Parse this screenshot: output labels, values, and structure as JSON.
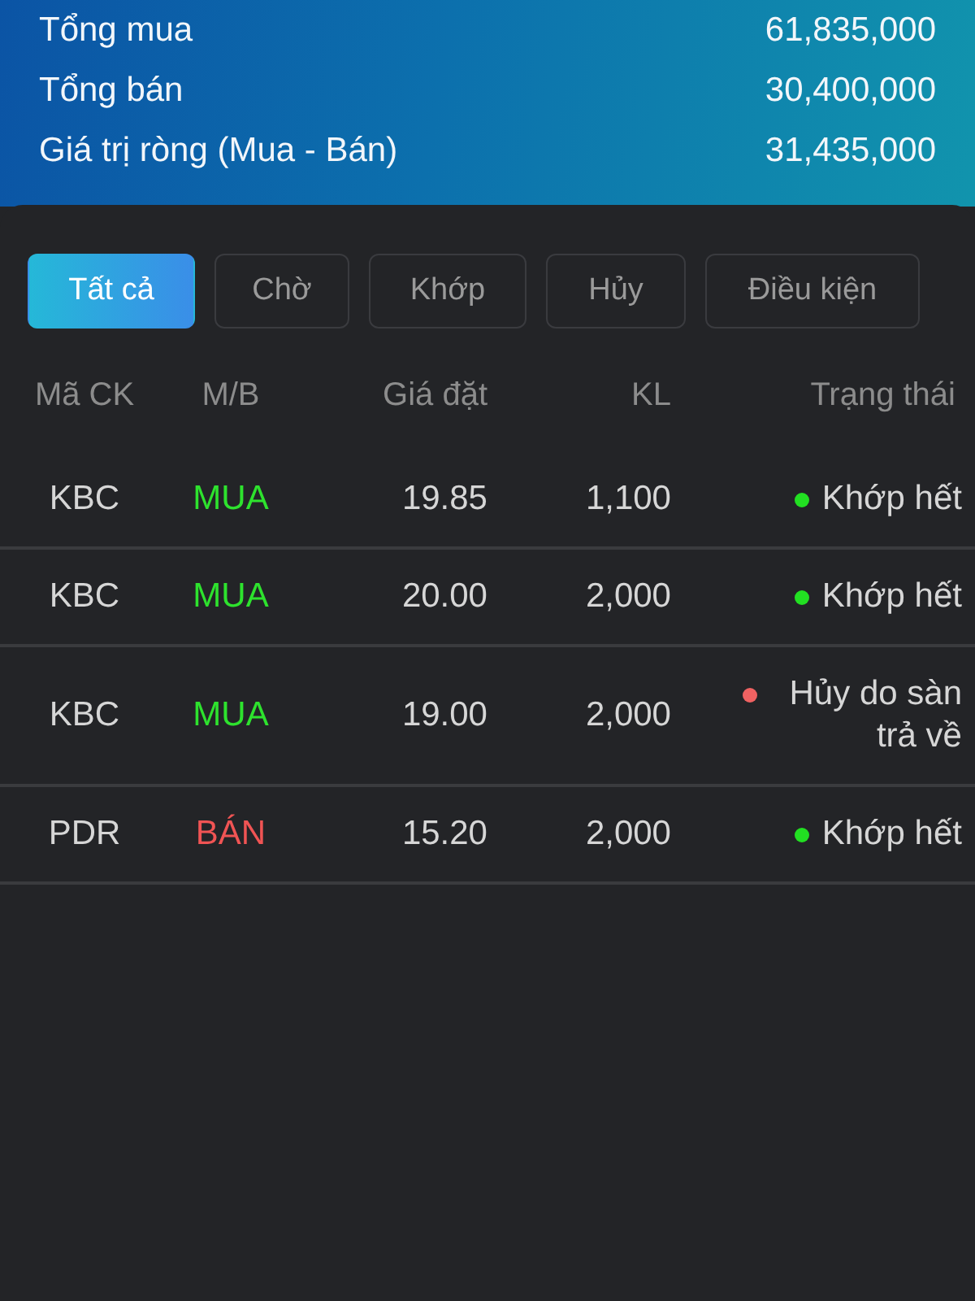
{
  "summary": [
    {
      "label": "Tổng mua",
      "value": "61,835,000"
    },
    {
      "label": "Tổng bán",
      "value": "30,400,000"
    },
    {
      "label": "Giá trị ròng (Mua - Bán)",
      "value": "31,435,000"
    }
  ],
  "tabs": [
    {
      "label": "Tất cả",
      "selected": true
    },
    {
      "label": "Chờ",
      "selected": false
    },
    {
      "label": "Khớp",
      "selected": false
    },
    {
      "label": "Hủy",
      "selected": false
    },
    {
      "label": "Điều kiện",
      "selected": false
    }
  ],
  "table": {
    "columns": [
      "Mã CK",
      "M/B",
      "Giá đặt",
      "KL",
      "Trạng thái"
    ],
    "rows": [
      {
        "symbol": "KBC",
        "side": {
          "text": "MUA",
          "kind": "buy"
        },
        "price": "19.85",
        "volume": "1,100",
        "status": {
          "text": "Khớp hết",
          "color": "#22e022"
        }
      },
      {
        "symbol": "KBC",
        "side": {
          "text": "MUA",
          "kind": "buy"
        },
        "price": "20.00",
        "volume": "2,000",
        "status": {
          "text": "Khớp hết",
          "color": "#22e022"
        }
      },
      {
        "symbol": "KBC",
        "side": {
          "text": "MUA",
          "kind": "buy"
        },
        "price": "19.00",
        "volume": "2,000",
        "status": {
          "text": "Hủy do sàn trả về",
          "color": "#f06262"
        }
      },
      {
        "symbol": "PDR",
        "side": {
          "text": "BÁN",
          "kind": "sell"
        },
        "price": "15.20",
        "volume": "2,000",
        "status": {
          "text": "Khớp hết",
          "color": "#22e022"
        }
      }
    ]
  }
}
